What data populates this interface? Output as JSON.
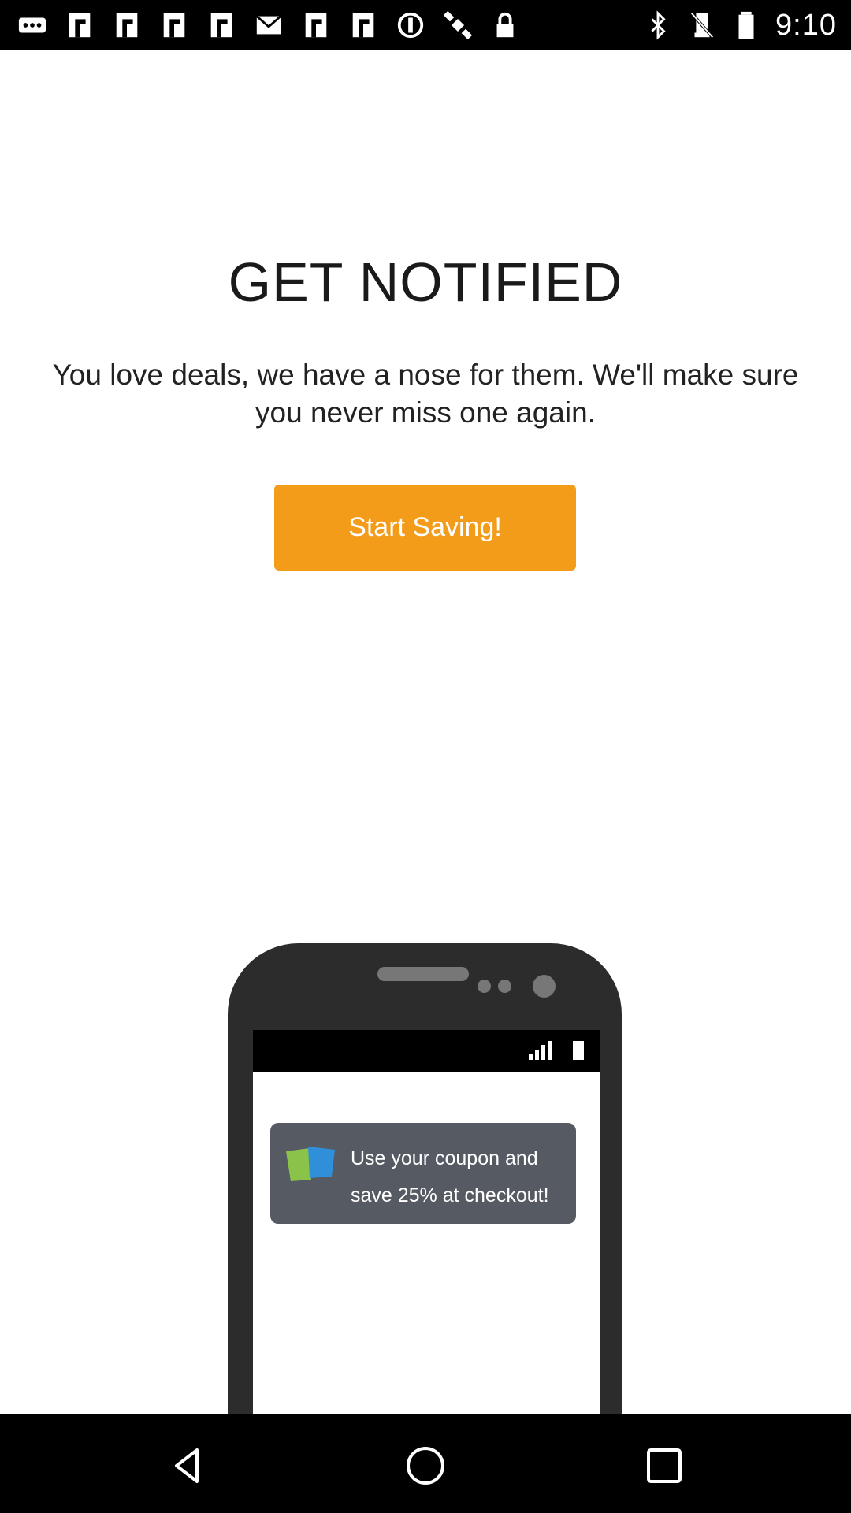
{
  "status_bar": {
    "time": "9:10",
    "left_icons": [
      "more-icon",
      "notification-f-icon",
      "notification-f-icon",
      "notification-f-icon",
      "notification-f-icon",
      "mail-icon",
      "notification-f-icon",
      "notification-f-icon",
      "circle-icon",
      "satellite-icon",
      "lock-icon"
    ],
    "right_icons": [
      "bluetooth-icon",
      "mute-icon",
      "battery-icon"
    ]
  },
  "content": {
    "title": "GET NOTIFIED",
    "subtitle": "You love deals, we have a nose for them. We'll make sure you never miss one again.",
    "cta_label": "Start Saving!"
  },
  "illustration": {
    "notification_text": "Use your coupon and save 25% at checkout!"
  },
  "nav_bar": {
    "buttons": [
      "back-icon",
      "home-icon",
      "recents-icon"
    ]
  },
  "colors": {
    "accent": "#f39c1a",
    "notification_bg": "#565a63",
    "phone_body": "#2c2c2c"
  }
}
